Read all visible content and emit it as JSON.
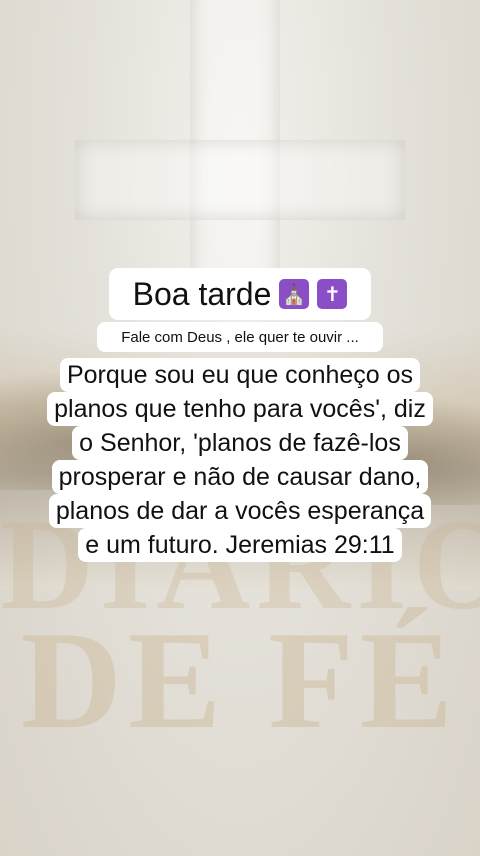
{
  "greeting": {
    "text": "Boa tarde",
    "emojis": [
      "🛐",
      "✝️"
    ]
  },
  "subtitle": "Fale com Deus , ele quer te ouvir ...",
  "verse_lines": [
    "Porque sou eu que conheço os",
    "planos que tenho para vocês', diz",
    "o Senhor, 'planos de fazê-los",
    "prosperar e não de causar dano,",
    "planos de dar a vocês esperança",
    "e um futuro. Jeremias 29:11"
  ],
  "background": {
    "watermark_line1": "DIÁRIO",
    "watermark_line2": "DE FÉ"
  },
  "colors": {
    "caption_bg": "#ffffff",
    "text": "#111111",
    "emoji_bg": "#8a4fc6"
  }
}
